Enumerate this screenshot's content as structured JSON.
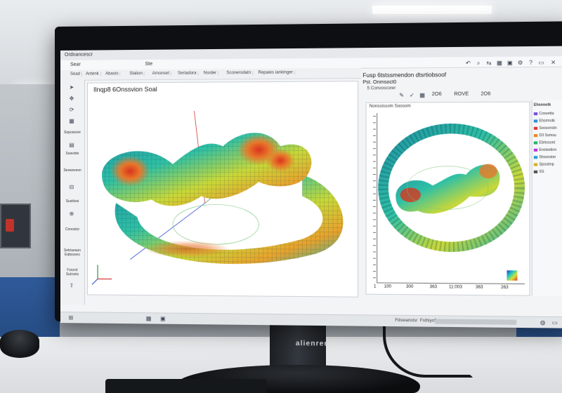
{
  "app": {
    "brand": "alienrer",
    "window_title": "Ordnancescr",
    "menu": [
      "Sear",
      "Ste"
    ],
    "toolbar": [
      "Sead",
      "Antenk",
      "Abasts",
      "Slation",
      "Arnonset",
      "Seriadora",
      "Nsrder",
      "Sconerodatn",
      "Repaies iankinger"
    ],
    "main_view_title": "Ilnqp8 6Onssvion Soal"
  },
  "left_tools": [
    {
      "icon": "cursor-icon",
      "label": ""
    },
    {
      "icon": "move-icon",
      "label": ""
    },
    {
      "icon": "rotate-icon",
      "label": ""
    },
    {
      "icon": "mesh-icon",
      "label": ""
    },
    {
      "icon": "zoom-icon",
      "label": "Soposesre"
    },
    {
      "icon": "layers-icon",
      "label": "Ssaviste"
    },
    {
      "icon": "measure-icon",
      "label": "Seswsvesn"
    },
    {
      "icon": "probe-icon",
      "label": "Suvitiosi"
    },
    {
      "icon": "section-icon",
      "label": "Conostor"
    },
    {
      "icon": "filter-icon",
      "label": "Setriaeaon Eabssses"
    },
    {
      "icon": "export-icon",
      "label": "Fsnent Sutrseis"
    }
  ],
  "right_panel": {
    "heading_line1": "Fusp 6tstssmendon dtsrtiobsoof",
    "heading_line2": "Pst.  Onmsoct0",
    "heading_line3": "5 Convoscorer",
    "toolbar_values": [
      "2O6",
      "ROVE",
      "2O6"
    ],
    "view_title": "Nonssissom Soosom",
    "x_labels": [
      "1",
      "100",
      "300",
      "363",
      "11:003",
      "363",
      "263"
    ]
  },
  "tree": {
    "title": "Ehsnnotk",
    "items": [
      {
        "label": "Cosvetta",
        "color": "#7a4ed8"
      },
      {
        "label": "Ehsrmotk",
        "color": "#2e8fd6"
      },
      {
        "label": "Soosonstn",
        "color": "#d63b3b"
      },
      {
        "label": "D3 Ssmsu",
        "color": "#e08a2a"
      },
      {
        "label": "Ebrtosont",
        "color": "#2ab26c"
      },
      {
        "label": "Enstsetion",
        "color": "#b83ad6"
      },
      {
        "label": "Shsooster",
        "color": "#2a9fd6"
      },
      {
        "label": "Sjsssimp",
        "color": "#d6b12a"
      },
      {
        "label": "SS",
        "color": "#555555"
      }
    ]
  },
  "status": {
    "left": "Fdswanstsr",
    "mid": "Fsthiyofi"
  }
}
